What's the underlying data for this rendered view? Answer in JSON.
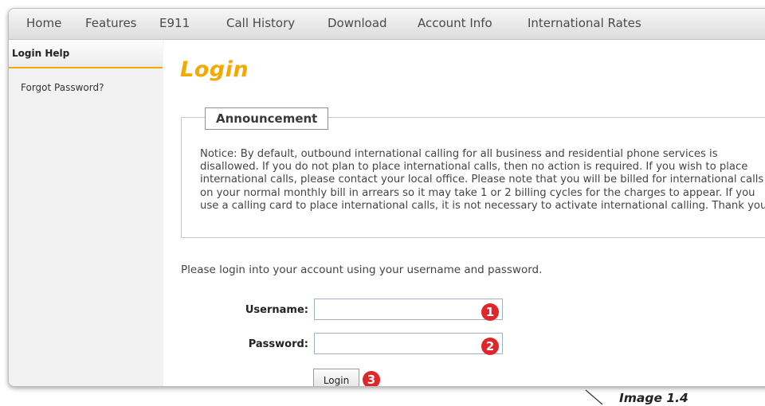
{
  "nav": {
    "items": [
      {
        "label": "Home"
      },
      {
        "label": "Features"
      },
      {
        "label": "E911"
      },
      {
        "label": "Call History"
      },
      {
        "label": "Download"
      },
      {
        "label": "Account Info"
      },
      {
        "label": "International Rates"
      }
    ]
  },
  "sidebar": {
    "header": "Login Help",
    "links": [
      {
        "label": "Forgot Password?"
      }
    ]
  },
  "main": {
    "title": "Login",
    "announcement": {
      "legend": "Announcement",
      "text": "Notice: By default, outbound international calling for all business and residential phone services is disallowed. If you do not plan to place international calls, then no action is required. If you wish to place international calls, please contact your local office. Please note that you will be billed for international calls on your normal monthly bill in arrears so it may take 1 or 2 billing cycles for the charges to appear. If you use a calling card to place international calls, it is not necessary to activate international calling. Thank you."
    },
    "intro": "Please login into your account using your username and password.",
    "form": {
      "username_label": "Username:",
      "username_value": "",
      "password_label": "Password:",
      "password_value": "",
      "login_label": "Login"
    }
  },
  "callouts": [
    "1",
    "2",
    "3"
  ],
  "caption": "Image 1.4",
  "colors": {
    "accent": "#f5a800",
    "badge": "#e0262a",
    "nav_text": "#4a4a4a"
  }
}
